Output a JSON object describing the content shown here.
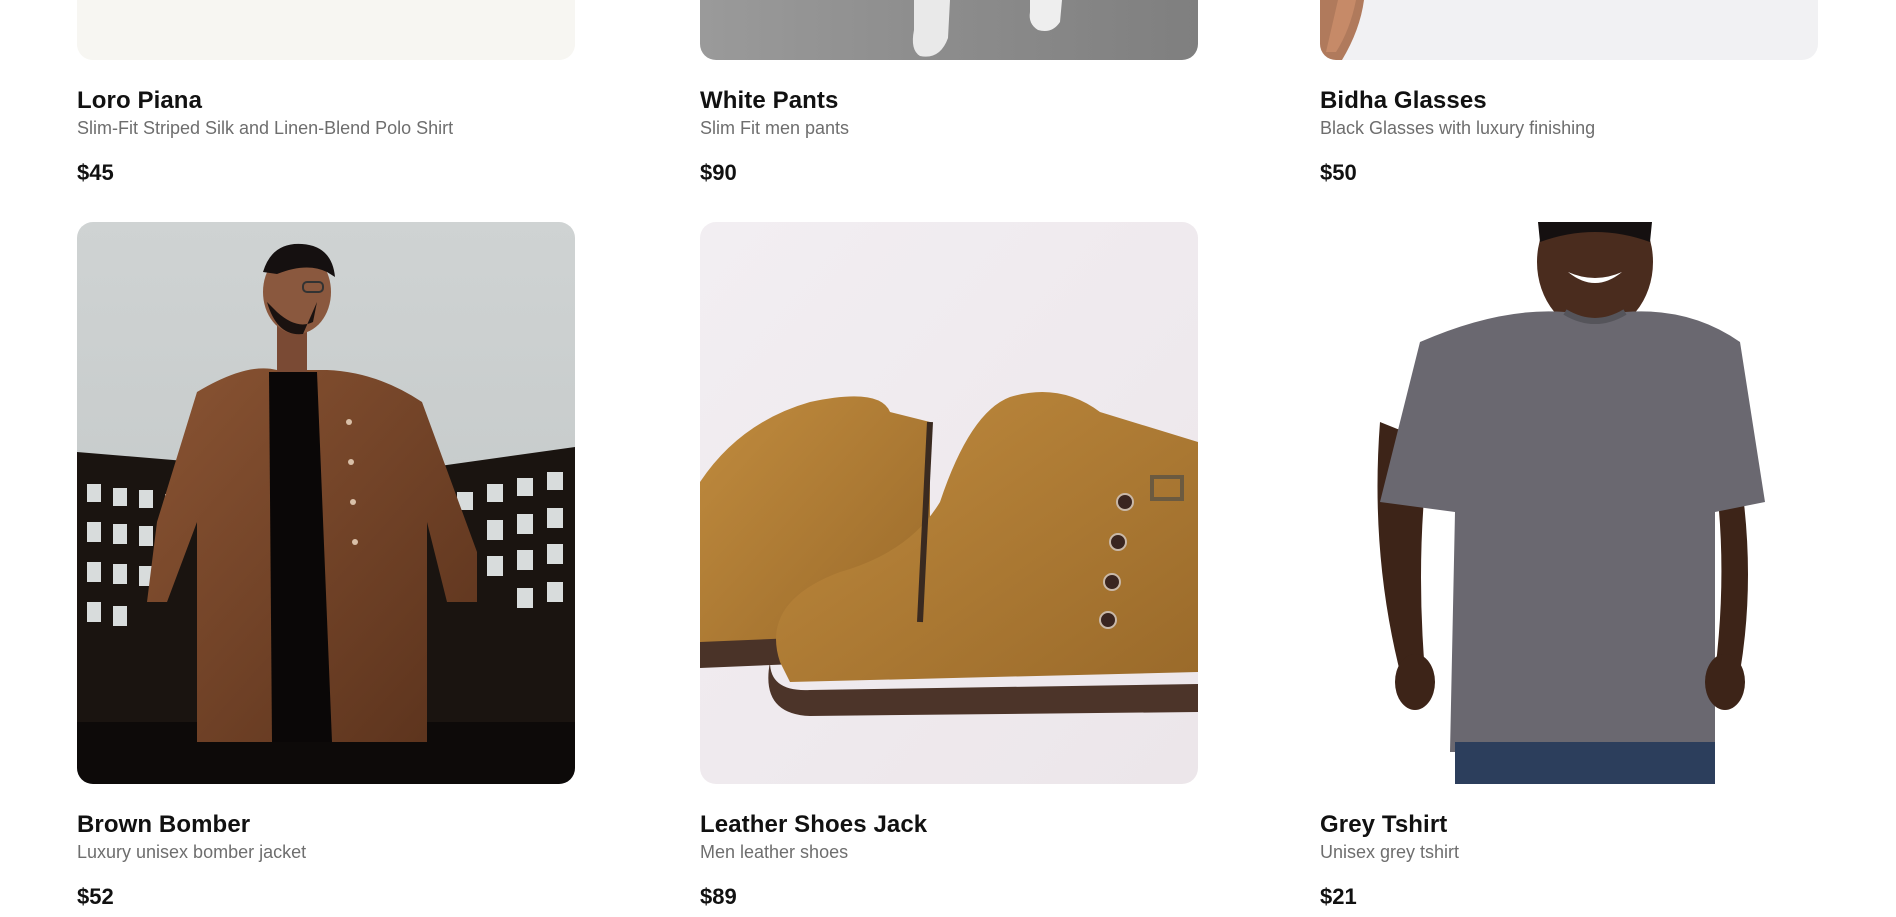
{
  "products": [
    {
      "name": "Loro Piana",
      "description": "Slim-Fit Striped Silk and Linen-Blend Polo Shirt",
      "price": "$45"
    },
    {
      "name": "White Pants",
      "description": "Slim Fit men pants",
      "price": "$90"
    },
    {
      "name": "Bidha Glasses",
      "description": "Black Glasses with luxury finishing",
      "price": "$50"
    },
    {
      "name": "Brown Bomber",
      "description": "Luxury unisex bomber jacket",
      "price": "$52"
    },
    {
      "name": "Leather Shoes Jack",
      "description": "Men leather shoes",
      "price": "$89"
    },
    {
      "name": "Grey Tshirt",
      "description": "Unisex grey tshirt",
      "price": "$21"
    }
  ],
  "colors": {
    "text": "#111111",
    "muted": "#6e6e6e",
    "background": "#ffffff"
  },
  "icons": {
    "product_images": [
      "polo-shirt-photo",
      "white-pants-photo",
      "glasses-photo",
      "bomber-jacket-photo",
      "leather-boots-photo",
      "grey-tshirt-photo"
    ]
  }
}
